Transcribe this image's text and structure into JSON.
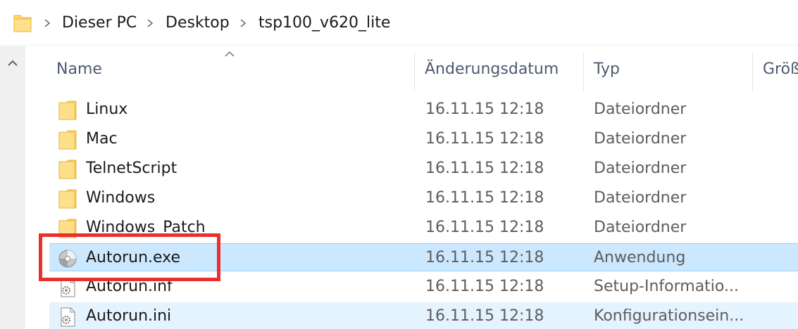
{
  "breadcrumb": {
    "items": [
      "Dieser PC",
      "Desktop",
      "tsp100_v620_lite"
    ]
  },
  "columns": {
    "name": "Name",
    "date": "Änderungsdatum",
    "type": "Typ",
    "size": "Größ"
  },
  "files": [
    {
      "name": "Linux",
      "date": "16.11.15 12:18",
      "type": "Dateiordner",
      "icon": "folder-icon"
    },
    {
      "name": "Mac",
      "date": "16.11.15 12:18",
      "type": "Dateiordner",
      "icon": "folder-icon"
    },
    {
      "name": "TelnetScript",
      "date": "16.11.15 12:18",
      "type": "Dateiordner",
      "icon": "folder-icon"
    },
    {
      "name": "Windows",
      "date": "16.11.15 12:18",
      "type": "Dateiordner",
      "icon": "folder-icon"
    },
    {
      "name": "Windows_Patch",
      "date": "16.11.15 12:18",
      "type": "Dateiordner",
      "icon": "folder-icon"
    },
    {
      "name": "Autorun.exe",
      "date": "16.11.15 12:18",
      "type": "Anwendung",
      "icon": "cd-disc-icon",
      "selected": true
    },
    {
      "name": "Autorun.inf",
      "date": "16.11.15 12:18",
      "type": "Setup-Informatio...",
      "icon": "settings-file-icon"
    },
    {
      "name": "Autorun.ini",
      "date": "16.11.15 12:18",
      "type": "Konfigurationsein...",
      "icon": "settings-file-icon",
      "hovered": true
    }
  ],
  "colors": {
    "selection": "#cce8ff",
    "highlight_box": "#e8302f",
    "folder": "#ffd766"
  }
}
